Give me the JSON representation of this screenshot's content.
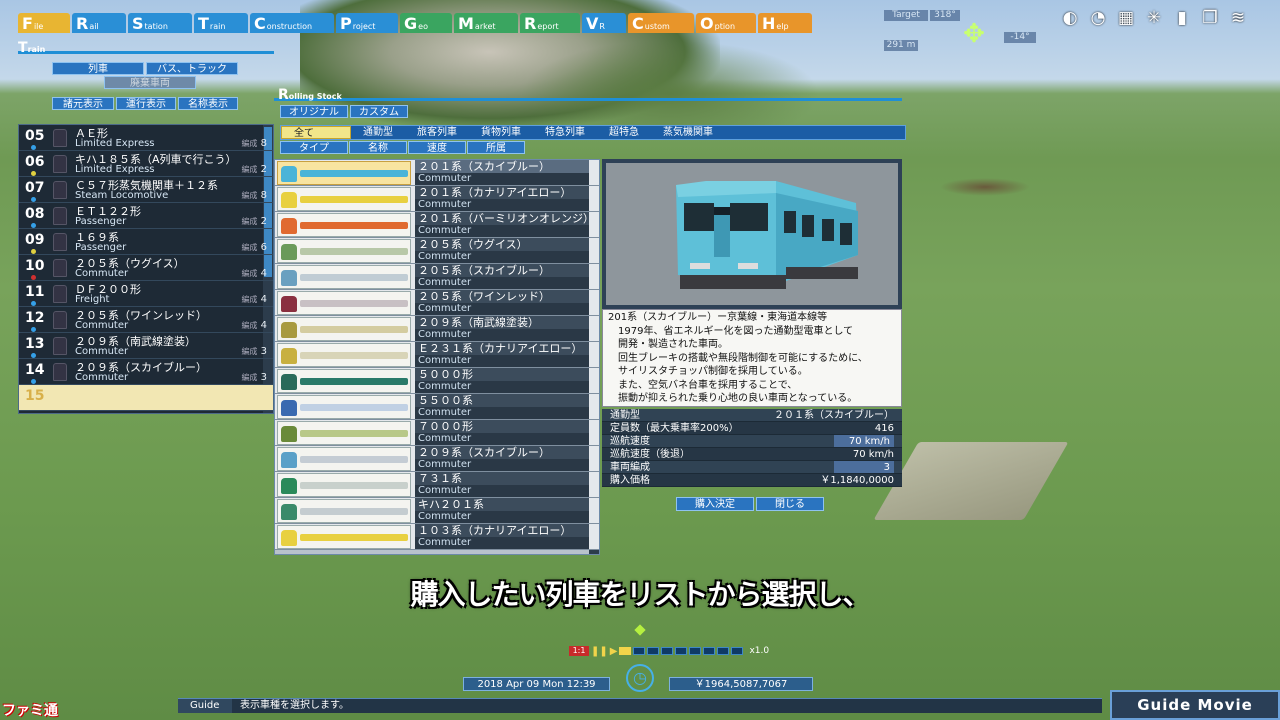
{
  "menu": [
    {
      "cap": "F",
      "rest": "ile",
      "color": "#e8b532"
    },
    {
      "cap": "R",
      "rest": "ail",
      "color": "#2a8fd6"
    },
    {
      "cap": "S",
      "rest": "tation",
      "color": "#2a8fd6"
    },
    {
      "cap": "T",
      "rest": "rain",
      "color": "#2a8fd6"
    },
    {
      "cap": "C",
      "rest": "onstruction",
      "color": "#2a8fd6"
    },
    {
      "cap": "P",
      "rest": "roject",
      "color": "#2a8fd6"
    },
    {
      "cap": "G",
      "rest": "eo",
      "color": "#3aa560"
    },
    {
      "cap": "M",
      "rest": "arket",
      "color": "#3aa560"
    },
    {
      "cap": "R",
      "rest": "eport",
      "color": "#3aa560"
    },
    {
      "cap": "V",
      "rest": "R",
      "color": "#2a8fd6"
    },
    {
      "cap": "C",
      "rest": "ustom",
      "color": "#e8952a"
    },
    {
      "cap": "O",
      "rest": "ption",
      "color": "#e8952a"
    },
    {
      "cap": "H",
      "rest": "elp",
      "color": "#e8952a"
    }
  ],
  "hud": {
    "target_label": "Target",
    "heading": "318°",
    "distance": "291 m",
    "tilt": "-14°"
  },
  "train_window": {
    "title_cap": "T",
    "title_rest": "rain",
    "tabs_top": [
      "列車",
      "バス、トラック"
    ],
    "tab_disabled": "廃棄車両",
    "tabs_view": [
      "諸元表示",
      "運行表示",
      "名称表示"
    ],
    "rows": [
      {
        "num": "05",
        "name": "ＡＥ形",
        "cat": "Limited Express",
        "cars": "8",
        "dot": "#35a0e8"
      },
      {
        "num": "06",
        "name": "キハ１８５系（A列車で行こう）",
        "cat": "Limited Express",
        "cars": "2",
        "dot": "#e0d040"
      },
      {
        "num": "07",
        "name": "Ｃ５７形蒸気機関車＋１２系",
        "cat": "Steam Locomotive",
        "cars": "8",
        "dot": "#35a0e8"
      },
      {
        "num": "08",
        "name": "ＥＴ１２２形",
        "cat": "Passenger",
        "cars": "2",
        "dot": "#35a0e8"
      },
      {
        "num": "09",
        "name": "１６９系",
        "cat": "Passenger",
        "cars": "6",
        "dot": "#e0d040"
      },
      {
        "num": "10",
        "name": "２０５系（ウグイス）",
        "cat": "Commuter",
        "cars": "4",
        "dot": "#d03030"
      },
      {
        "num": "11",
        "name": "ＤＦ２００形",
        "cat": "Freight",
        "cars": "4",
        "dot": "#35a0e8"
      },
      {
        "num": "12",
        "name": "２０５系（ワインレッド）",
        "cat": "Commuter",
        "cars": "4",
        "dot": "#35a0e8"
      },
      {
        "num": "13",
        "name": "２０９系（南武線塗装）",
        "cat": "Commuter",
        "cars": "3",
        "dot": "#35a0e8"
      },
      {
        "num": "14",
        "name": "２０９系（スカイブルー）",
        "cat": "Commuter",
        "cars": "3",
        "dot": "#35a0e8"
      }
    ],
    "empty_row": "15",
    "cars_label": "編成"
  },
  "rolling_stock": {
    "title_cap": "R",
    "title_rest": "olling Stock",
    "tabs": [
      "オリジナル",
      "カスタム"
    ],
    "categories": [
      "全て",
      "通勤型",
      "旅客列車",
      "貨物列車",
      "特急列車",
      "超特急",
      "蒸気機関車"
    ],
    "sorts": [
      "タイプ",
      "名称",
      "速度",
      "所属"
    ],
    "items": [
      {
        "name": "２０１系（スカイブルー）",
        "cat": "Commuter",
        "body": "#4ab4d8",
        "loco": "#4ab4d8"
      },
      {
        "name": "２０１系（カナリアイエロー）",
        "cat": "Commuter",
        "body": "#e8d040",
        "loco": "#e8d040"
      },
      {
        "name": "２０１系（バーミリオンオレンジ）",
        "cat": "Commuter",
        "body": "#e06a30",
        "loco": "#e06a30"
      },
      {
        "name": "２０５系（ウグイス）",
        "cat": "Commuter",
        "body": "#b8c8a8",
        "loco": "#6a9a5a"
      },
      {
        "name": "２０５系（スカイブルー）",
        "cat": "Commuter",
        "body": "#c0ccd4",
        "loco": "#6aa0c0"
      },
      {
        "name": "２０５系（ワインレッド）",
        "cat": "Commuter",
        "body": "#c8c0c4",
        "loco": "#8a3040"
      },
      {
        "name": "２０９系（南武線塗装）",
        "cat": "Commuter",
        "body": "#d4cca0",
        "loco": "#a89a40"
      },
      {
        "name": "Ｅ２３１系（カナリアイエロー）",
        "cat": "Commuter",
        "body": "#d8d4b8",
        "loco": "#c8b040"
      },
      {
        "name": "５０００形",
        "cat": "Commuter",
        "body": "#2a7a6a",
        "loco": "#2a6a5a"
      },
      {
        "name": "５５００系",
        "cat": "Commuter",
        "body": "#c0d0e4",
        "loco": "#3a6ab0"
      },
      {
        "name": "７０００形",
        "cat": "Commuter",
        "body": "#b8c888",
        "loco": "#6a8a3a"
      },
      {
        "name": "２０９系（スカイブルー）",
        "cat": "Commuter",
        "body": "#c4ccd4",
        "loco": "#5aa0c8"
      },
      {
        "name": "７３１系",
        "cat": "Commuter",
        "body": "#c8d0cc",
        "loco": "#2a8a5a"
      },
      {
        "name": "キハ２０１系",
        "cat": "Commuter",
        "body": "#c4ccd0",
        "loco": "#3a8a6a"
      },
      {
        "name": "１０３系（カナリアイエロー）",
        "cat": "Commuter",
        "body": "#e8d040",
        "loco": "#e8d040"
      }
    ],
    "description": [
      "201系（スカイブルー）ー京葉線・東海道本線等",
      "　1979年、省エネルギー化を図った通勤型電車として",
      "　開発・製造された車両。",
      "　回生ブレーキの搭載や無段階制御を可能にするために、",
      "　サイリスタチョッパ制御を採用している。",
      "　また、空気バネ台車を採用することで、",
      "　振動が抑えられた乗り心地の良い車両となっている。"
    ],
    "specs": [
      {
        "k": "通勤型",
        "v": "２０１系（スカイブルー）"
      },
      {
        "k": "定員数（最大乗車率200%）",
        "v": "416"
      },
      {
        "k": "巡航速度",
        "v": "70 km/h",
        "box": true
      },
      {
        "k": "巡航速度（後退）",
        "v": "70 km/h"
      },
      {
        "k": "車両編成",
        "v": "3",
        "box": true
      },
      {
        "k": "購入価格",
        "v": "￥1,1840,0000"
      }
    ],
    "buy_label": "購入決定",
    "close_label": "閉じる"
  },
  "subtitle": "購入したい列車をリストから選択し、",
  "status": {
    "ratio": "1:1",
    "multiplier": "x1.0",
    "date": "2018 Apr 09 Mon 12:39",
    "money": "￥1964,5087,7067",
    "guide_label": "Guide",
    "guide_text": "表示車種を選択します。"
  },
  "brand": "Guide Movie",
  "watermark": "ファミ通"
}
